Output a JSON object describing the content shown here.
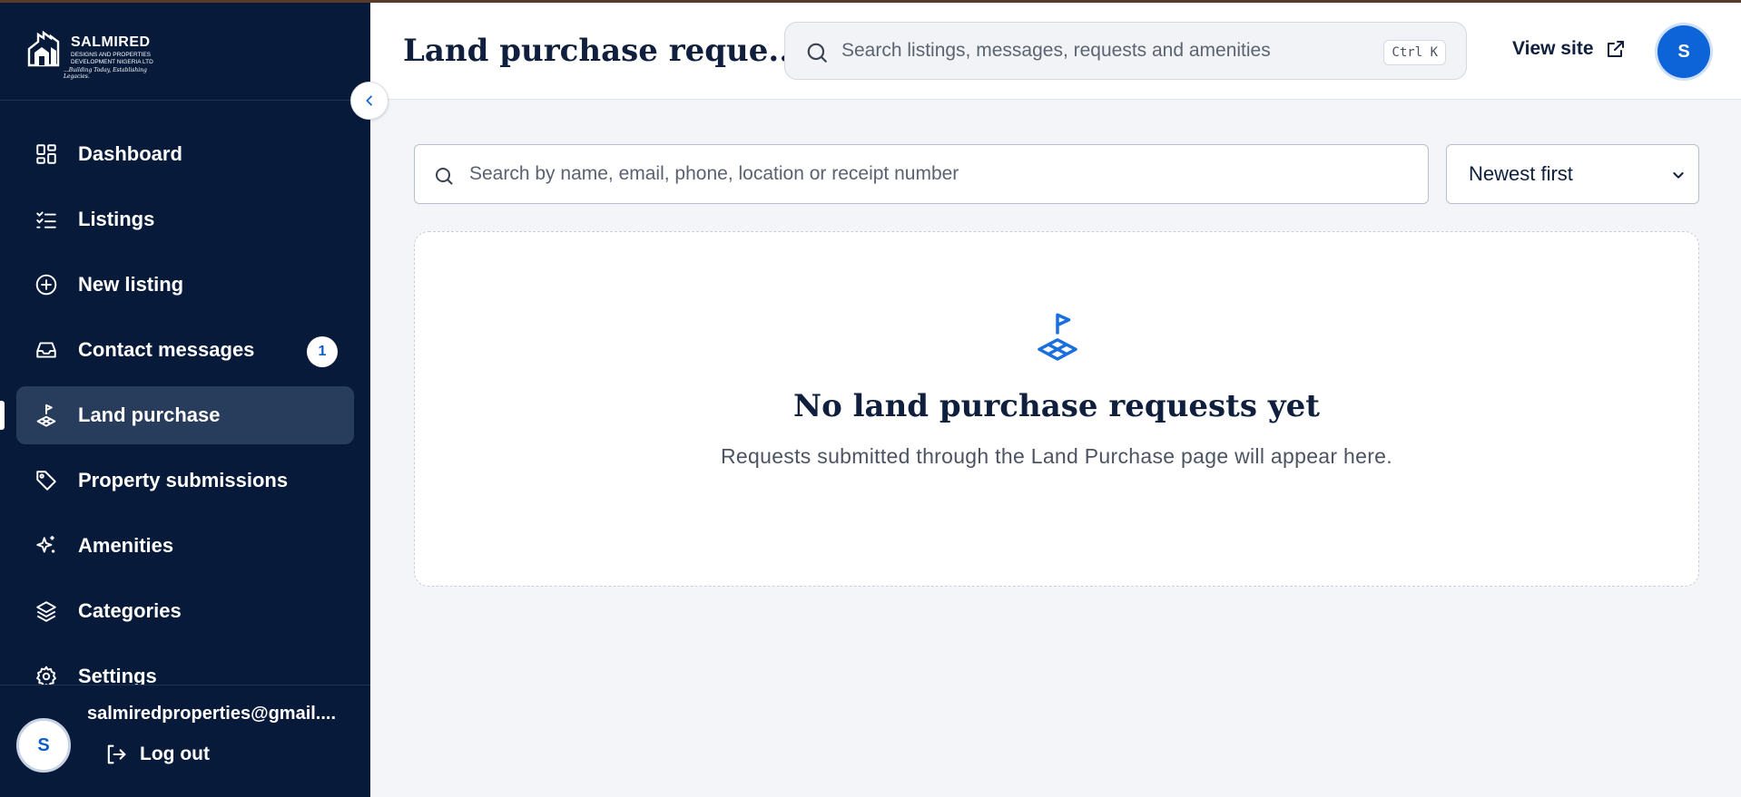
{
  "brand": {
    "name": "SALMIRED",
    "subtitle": "DESIGNS AND PROPERTIES DEVELOPMENT NIGERIA LTD",
    "tagline": "...Building Today, Establishing Legacies."
  },
  "sidebar": {
    "items": [
      {
        "label": "Dashboard",
        "icon": "dashboard-grid-icon"
      },
      {
        "label": "Listings",
        "icon": "checklist-icon"
      },
      {
        "label": "New listing",
        "icon": "plus-circle-icon"
      },
      {
        "label": "Contact messages",
        "icon": "inbox-icon",
        "badge": "1"
      },
      {
        "label": "Land purchase",
        "icon": "land-flag-icon",
        "active": true
      },
      {
        "label": "Property submissions",
        "icon": "tag-icon"
      },
      {
        "label": "Amenities",
        "icon": "sparkles-icon"
      },
      {
        "label": "Categories",
        "icon": "layers-icon"
      },
      {
        "label": "Settings",
        "icon": "gear-icon"
      }
    ],
    "footer": {
      "avatar_initial": "S",
      "email": "salmiredproperties@gmail....",
      "logout_label": "Log out"
    }
  },
  "header": {
    "title": "Land purchase reque...",
    "search_placeholder": "Search listings, messages, requests and amenities",
    "shortcut": "Ctrl K",
    "view_site_label": "View site",
    "avatar_initial": "S"
  },
  "filters": {
    "search_placeholder": "Search by name, email, phone, location or receipt number",
    "sort_selected": "Newest first"
  },
  "empty_state": {
    "title": "No land purchase requests yet",
    "subtitle": "Requests submitted through the Land Purchase page will appear here."
  },
  "colors": {
    "sidebar_bg": "#071a3a",
    "sidebar_active": "#283c5c",
    "accent": "#0d63d8",
    "page_bg": "#f4f5f8"
  }
}
